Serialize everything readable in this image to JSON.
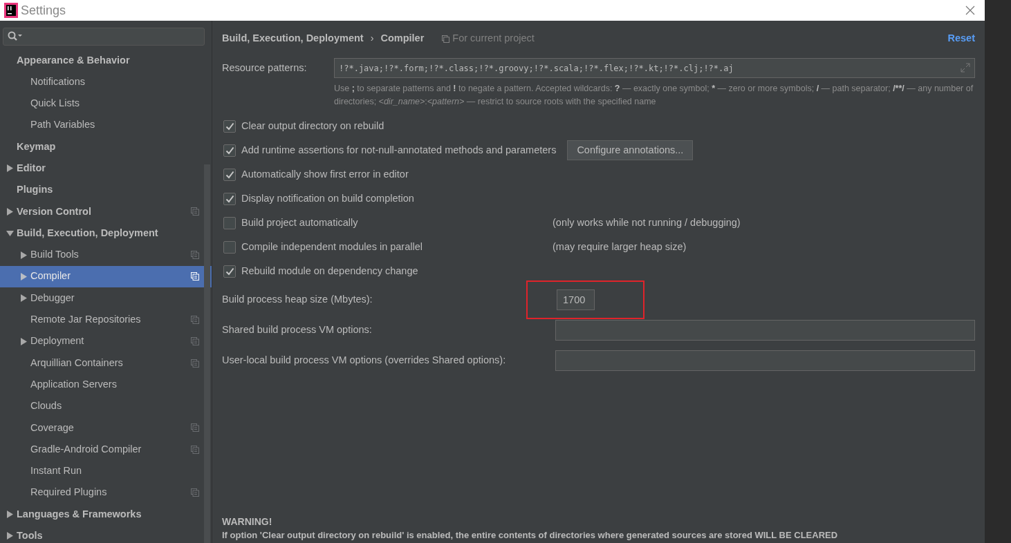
{
  "window": {
    "title": "Settings"
  },
  "sidebar": {
    "items": [
      {
        "label": "Appearance & Behavior",
        "expandable": false,
        "selected": false,
        "project_level": false,
        "children": [
          {
            "label": "Notifications",
            "expandable": false,
            "selected": false,
            "project_level": false
          },
          {
            "label": "Quick Lists",
            "expandable": false,
            "selected": false,
            "project_level": false
          },
          {
            "label": "Path Variables",
            "expandable": false,
            "selected": false,
            "project_level": false
          }
        ]
      },
      {
        "label": "Keymap",
        "expandable": false,
        "selected": false,
        "project_level": false
      },
      {
        "label": "Editor",
        "expandable": true,
        "expanded": false,
        "selected": false,
        "project_level": false
      },
      {
        "label": "Plugins",
        "expandable": false,
        "selected": false,
        "project_level": false
      },
      {
        "label": "Version Control",
        "expandable": true,
        "expanded": false,
        "selected": false,
        "project_level": true
      },
      {
        "label": "Build, Execution, Deployment",
        "expandable": true,
        "expanded": true,
        "selected": false,
        "project_level": false,
        "children": [
          {
            "label": "Build Tools",
            "expandable": true,
            "expanded": false,
            "selected": false,
            "project_level": true
          },
          {
            "label": "Compiler",
            "expandable": true,
            "expanded": false,
            "selected": true,
            "project_level": true
          },
          {
            "label": "Debugger",
            "expandable": true,
            "expanded": false,
            "selected": false,
            "project_level": false
          },
          {
            "label": "Remote Jar Repositories",
            "expandable": false,
            "selected": false,
            "project_level": true
          },
          {
            "label": "Deployment",
            "expandable": true,
            "expanded": false,
            "selected": false,
            "project_level": true
          },
          {
            "label": "Arquillian Containers",
            "expandable": false,
            "selected": false,
            "project_level": true
          },
          {
            "label": "Application Servers",
            "expandable": false,
            "selected": false,
            "project_level": false
          },
          {
            "label": "Clouds",
            "expandable": false,
            "selected": false,
            "project_level": false
          },
          {
            "label": "Coverage",
            "expandable": false,
            "selected": false,
            "project_level": true
          },
          {
            "label": "Gradle-Android Compiler",
            "expandable": false,
            "selected": false,
            "project_level": true
          },
          {
            "label": "Instant Run",
            "expandable": false,
            "selected": false,
            "project_level": false
          },
          {
            "label": "Required Plugins",
            "expandable": false,
            "selected": false,
            "project_level": true
          }
        ]
      },
      {
        "label": "Languages & Frameworks",
        "expandable": true,
        "expanded": false,
        "selected": false,
        "project_level": false
      },
      {
        "label": "Tools",
        "expandable": true,
        "expanded": false,
        "selected": false,
        "project_level": false
      }
    ]
  },
  "header": {
    "breadcrumbs": [
      "Build, Execution, Deployment",
      "Compiler"
    ],
    "separator": "›",
    "scope": "For current project",
    "reset": "Reset"
  },
  "resource_patterns": {
    "label": "Resource patterns:",
    "value": "!?*.java;!?*.form;!?*.class;!?*.groovy;!?*.scala;!?*.flex;!?*.kt;!?*.clj;!?*.aj",
    "hint": [
      {
        "kind": "plain",
        "text": "Use "
      },
      {
        "kind": "bold",
        "text": ";"
      },
      {
        "kind": "plain",
        "text": " to separate patterns and "
      },
      {
        "kind": "bold",
        "text": "!"
      },
      {
        "kind": "plain",
        "text": " to negate a pattern. Accepted wildcards: "
      },
      {
        "kind": "bold",
        "text": "?"
      },
      {
        "kind": "plain",
        "text": " — exactly one symbol; "
      },
      {
        "kind": "bold",
        "text": "*"
      },
      {
        "kind": "plain",
        "text": " — zero or more symbols; "
      },
      {
        "kind": "bold",
        "text": "/"
      },
      {
        "kind": "plain",
        "text": " — path separator; "
      },
      {
        "kind": "bold",
        "text": "/**/"
      },
      {
        "kind": "plain",
        "text": " — any number of directories; "
      },
      {
        "kind": "italic",
        "text": "<dir_name>"
      },
      {
        "kind": "plain",
        "text": ":"
      },
      {
        "kind": "italic",
        "text": "<pattern>"
      },
      {
        "kind": "plain",
        "text": " — restrict to source roots with the specified name"
      }
    ]
  },
  "options": [
    {
      "label": "Clear output directory on rebuild",
      "checked": true
    },
    {
      "label": "Add runtime assertions for not-null-annotated methods and parameters",
      "checked": true,
      "button": "Configure annotations..."
    },
    {
      "label": "Automatically show first error in editor",
      "checked": true
    },
    {
      "label": "Display notification on build completion",
      "checked": true
    },
    {
      "label": "Build project automatically",
      "checked": false,
      "note": "(only works while not running / debugging)"
    },
    {
      "label": "Compile independent modules in parallel",
      "checked": false,
      "note": "(may require larger heap size)"
    },
    {
      "label": "Rebuild module on dependency change",
      "checked": true
    }
  ],
  "fields": [
    {
      "kind": "short",
      "label": "Build process heap size (Mbytes):",
      "value": "1700",
      "highlighted": true
    },
    {
      "kind": "wide",
      "label": "Shared build process VM options:",
      "highlighted": false
    },
    {
      "kind": "wide",
      "label": "User-local build process VM options (overrides Shared options):",
      "highlighted": false
    }
  ],
  "warning": {
    "title": "WARNING!",
    "text": "If option 'Clear output directory on rebuild' is enabled, the entire contents of directories where generated sources are stored WILL BE CLEARED"
  }
}
